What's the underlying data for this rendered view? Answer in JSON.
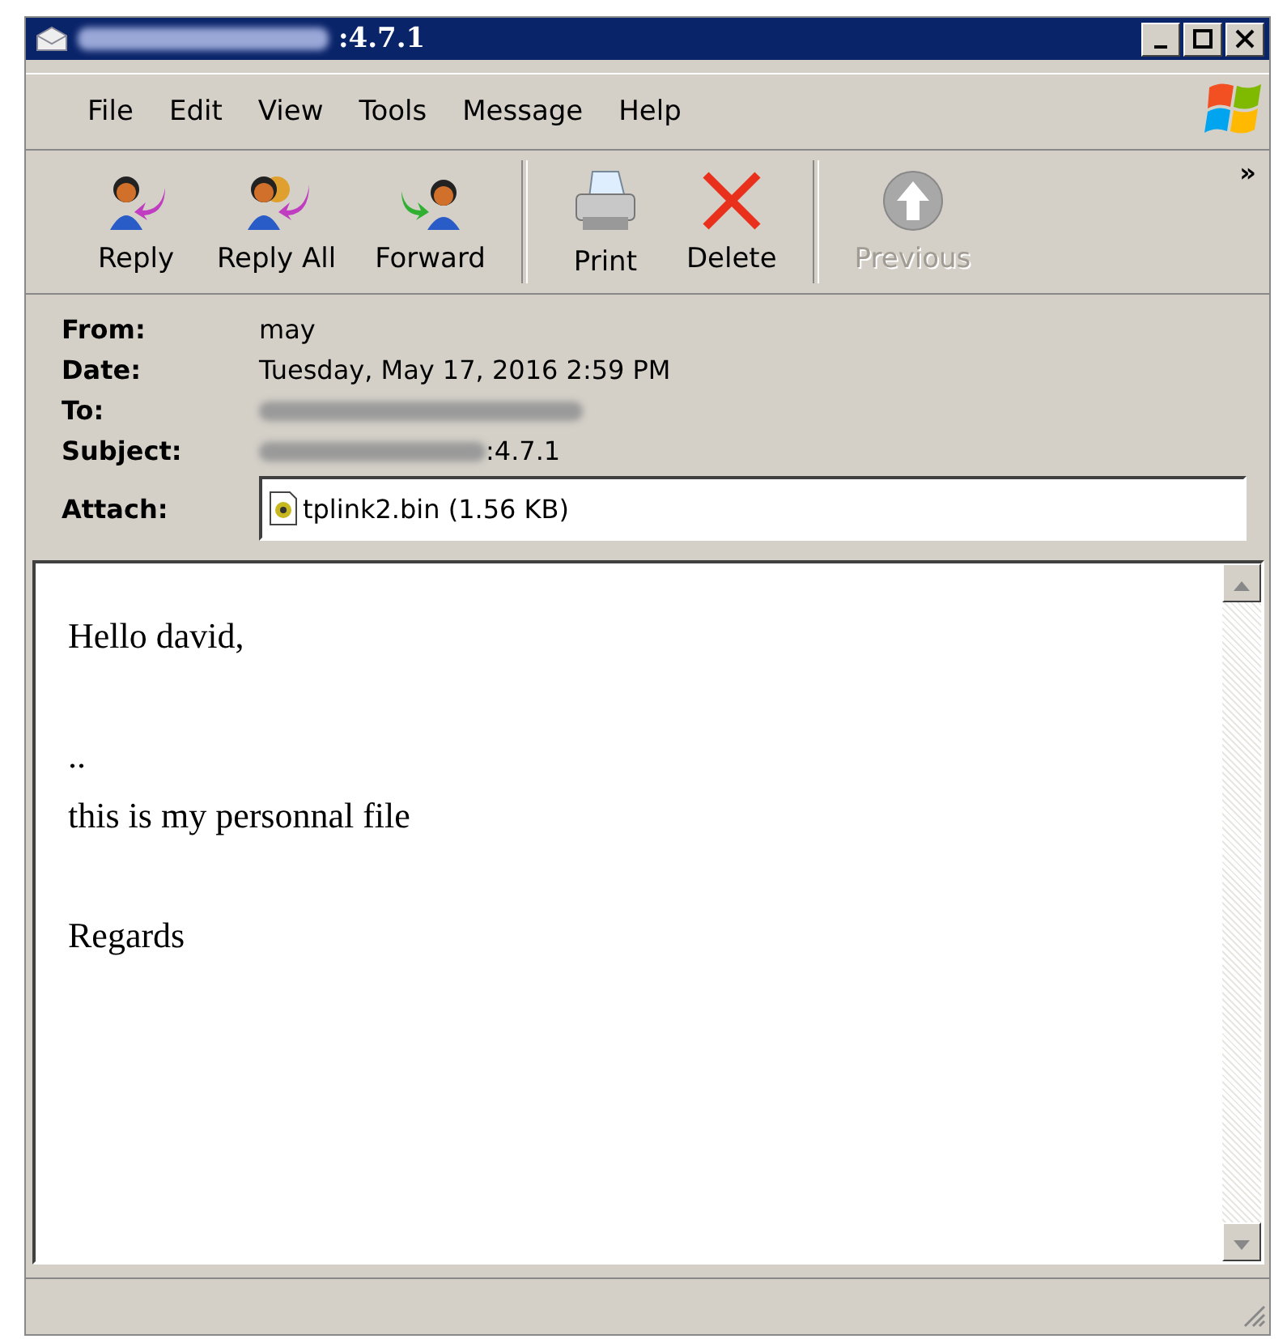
{
  "window": {
    "title": ":4.7.1",
    "title_redacted": true
  },
  "menu": [
    "File",
    "Edit",
    "View",
    "Tools",
    "Message",
    "Help"
  ],
  "toolbar": [
    {
      "kind": "reply",
      "label": "Reply",
      "disabled": false
    },
    {
      "kind": "reply_all",
      "label": "Reply All",
      "disabled": false
    },
    {
      "kind": "forward",
      "label": "Forward",
      "disabled": false
    },
    {
      "kind": "separator"
    },
    {
      "kind": "print",
      "label": "Print",
      "disabled": false
    },
    {
      "kind": "delete",
      "label": "Delete",
      "disabled": false
    },
    {
      "kind": "separator"
    },
    {
      "kind": "previous",
      "label": "Previous",
      "disabled": true
    }
  ],
  "toolbar_overflow": "»",
  "headers": [
    {
      "label": "From:",
      "value": "may",
      "redacted": false
    },
    {
      "label": "Date:",
      "value": "Tuesday, May 17, 2016 2:59 PM",
      "redacted": false
    },
    {
      "label": "To:",
      "redacted": true
    },
    {
      "label": "Subject:",
      "value": ":4.7.1",
      "redacted": true
    }
  ],
  "attach": {
    "label": "Attach:",
    "file": "tplink2.bin (1.56 KB)"
  },
  "body": [
    [
      "Hello david,"
    ],
    [
      "..",
      "this is my personnal file"
    ],
    [
      "Regards"
    ]
  ]
}
